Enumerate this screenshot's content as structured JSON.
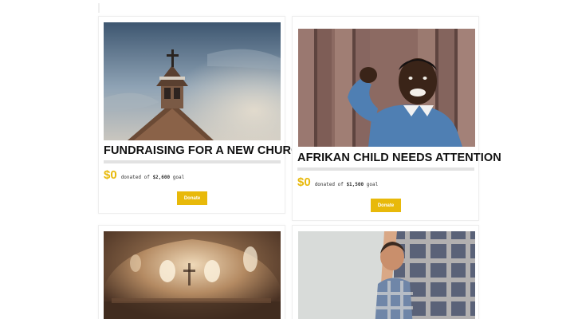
{
  "campaigns": [
    {
      "title": "FUNDRAISING FOR A NEW CHURCH",
      "amount": "$0",
      "donated_label": "donated of",
      "goal_amount": "$2,600",
      "goal_label": "goal",
      "button_label": "Donate",
      "image": "church-steeple-photo"
    },
    {
      "title": "AFRIKAN CHILD NEEDS ATTENTION",
      "amount": "$0",
      "donated_label": "donated of",
      "goal_amount": "$1,500",
      "goal_label": "goal",
      "button_label": "Donate",
      "image": "child-photo"
    },
    {
      "image": "church-interior-photo"
    },
    {
      "image": "child-hugging-parent-photo"
    }
  ],
  "colors": {
    "accent": "#e8b90a",
    "title": "#111111",
    "progress_track": "#e2e2e2"
  },
  "progress_values": [
    0,
    0
  ]
}
